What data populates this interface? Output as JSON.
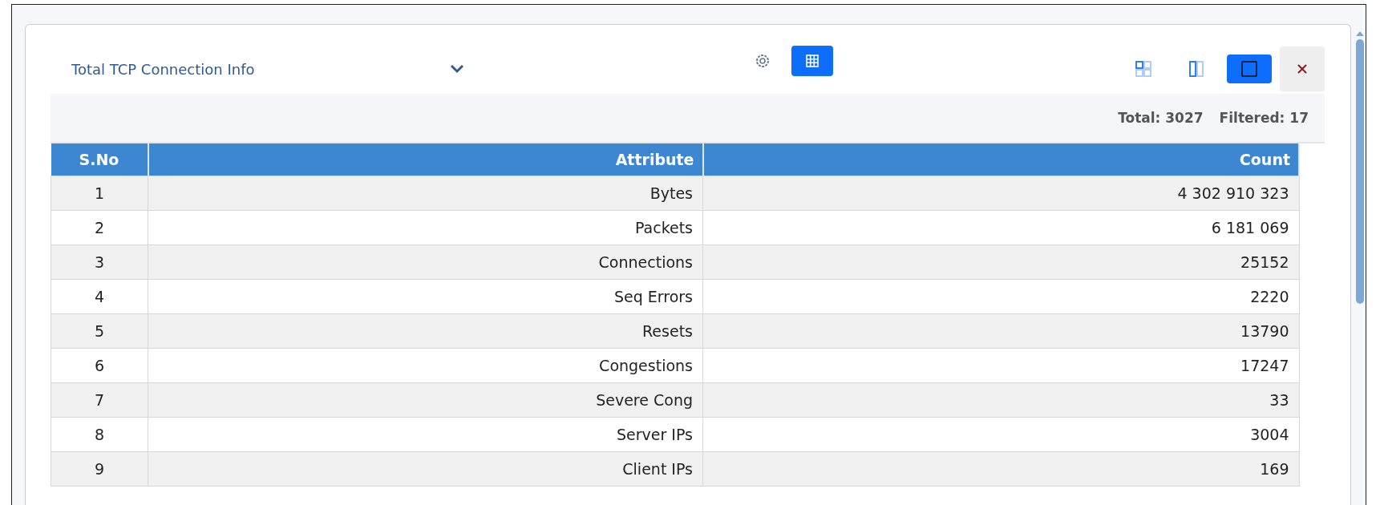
{
  "panel": {
    "title": "Total TCP Connection Info"
  },
  "toolbar": {
    "settings": {
      "selected": false
    },
    "grid_view": {
      "selected": true
    }
  },
  "layouts": [
    {
      "kind": "quad",
      "selected": false
    },
    {
      "kind": "split",
      "selected": false
    },
    {
      "kind": "single",
      "selected": true
    }
  ],
  "summary": {
    "total": "Total: 3027",
    "filtered": "Filtered: 17"
  },
  "table": {
    "columns": [
      "S.No",
      "Attribute",
      "Count"
    ],
    "rows": [
      [
        "1",
        "Bytes",
        "4 302 910 323"
      ],
      [
        "2",
        "Packets",
        "6 181 069"
      ],
      [
        "3",
        "Connections",
        "25152"
      ],
      [
        "4",
        "Seq Errors",
        "2220"
      ],
      [
        "5",
        "Resets",
        "13790"
      ],
      [
        "6",
        "Congestions",
        "17247"
      ],
      [
        "7",
        "Severe Cong",
        "33"
      ],
      [
        "8",
        "Server IPs",
        "3004"
      ],
      [
        "9",
        "Client IPs",
        "169"
      ]
    ]
  }
}
